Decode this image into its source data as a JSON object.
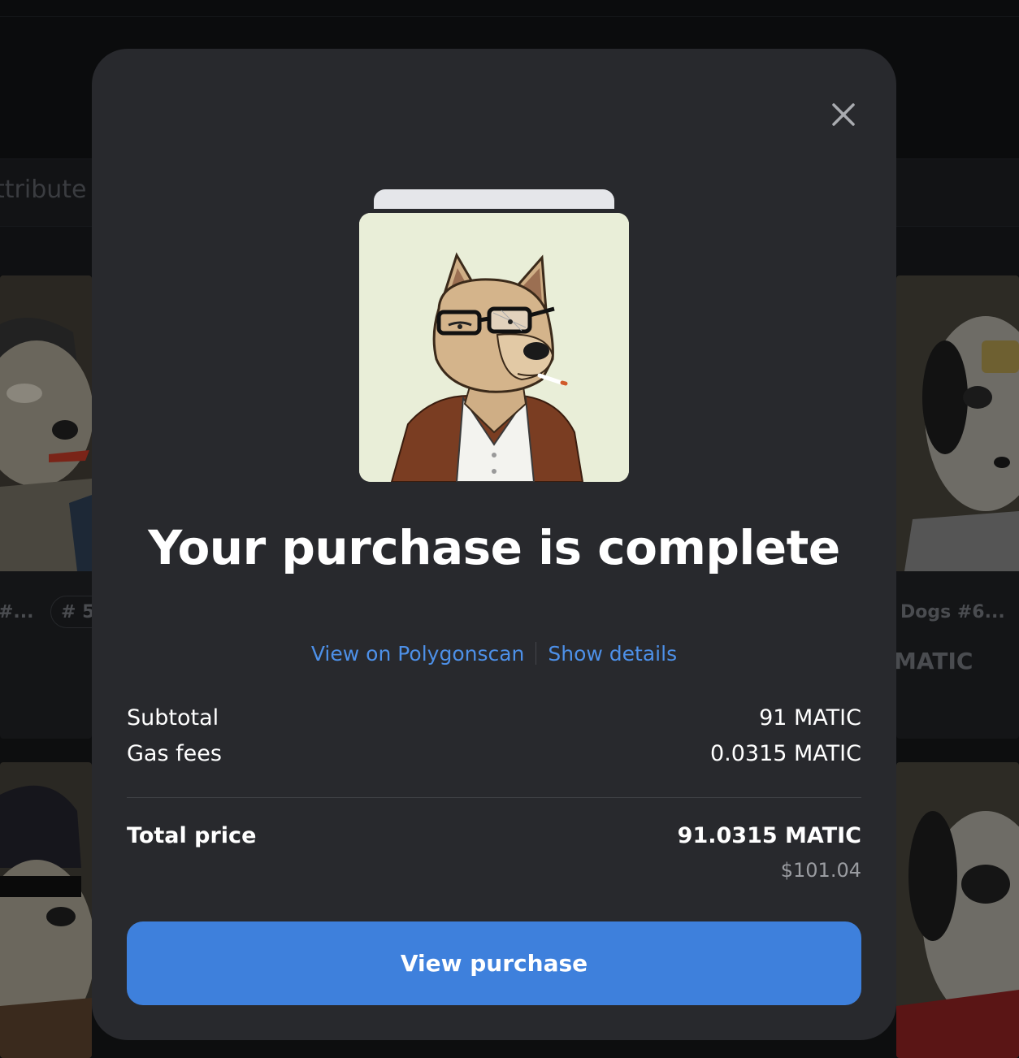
{
  "background": {
    "filter_text": "ttribute",
    "card_labels": [
      "#...",
      "# 5",
      "Dogs #6...",
      "MATIC"
    ]
  },
  "modal": {
    "close_icon": "close-icon",
    "title": "Your purchase is complete",
    "links": {
      "explorer": "View on Polygonscan",
      "details": "Show details"
    },
    "summary": {
      "subtotal_label": "Subtotal",
      "subtotal_value": "91 MATIC",
      "gas_label": "Gas fees",
      "gas_value": "0.0315 MATIC",
      "total_label": "Total price",
      "total_value": "91.0315 MATIC",
      "total_usd": "$101.04"
    },
    "cta_label": "View purchase"
  },
  "colors": {
    "modal_bg": "#28292d",
    "link": "#4d90e8",
    "button": "#3e80dc",
    "nft_bg": "#e9eed8"
  }
}
